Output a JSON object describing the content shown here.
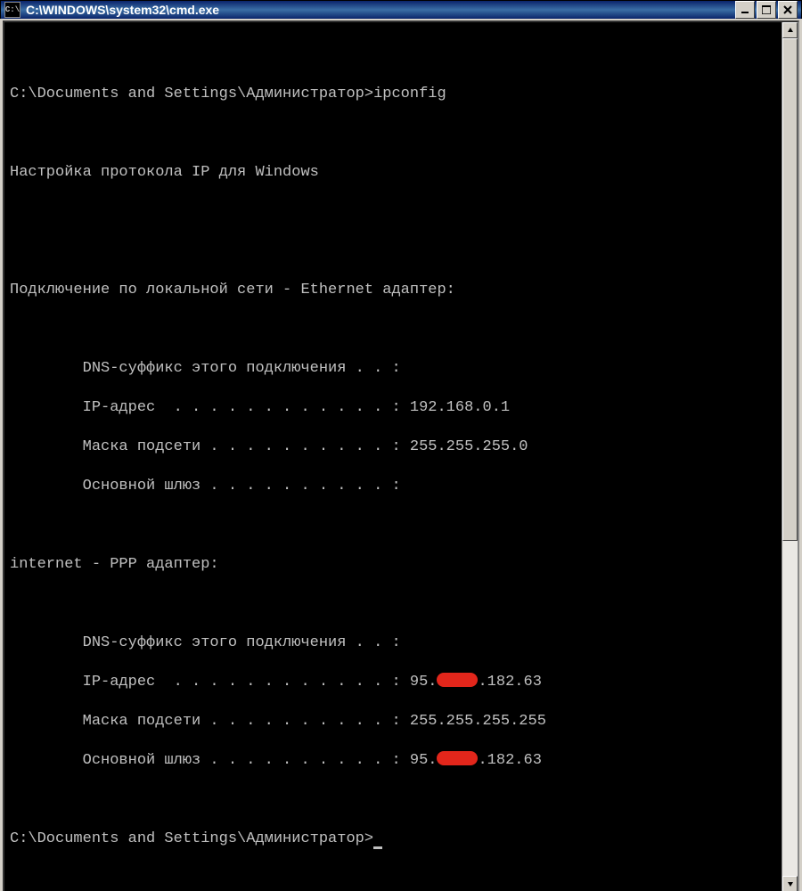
{
  "window": {
    "title": "C:\\WINDOWS\\system32\\cmd.exe",
    "icon_text": "C:\\"
  },
  "terminal": {
    "prompt1_path": "C:\\Documents and Settings\\Администратор>",
    "prompt1_cmd": "ipconfig",
    "header": "Настройка протокола IP для Windows",
    "adapter1_title": "Подключение по локальной сети - Ethernet адаптер:",
    "adapter1": {
      "dns_label": "        DNS-суффикс этого подключения . . :",
      "ip_label": "        IP-адрес  . . . . . . . . . . . . :",
      "ip_value": " 192.168.0.1",
      "mask_label": "        Маска подсети . . . . . . . . . . :",
      "mask_value": " 255.255.255.0",
      "gw_label": "        Основной шлюз . . . . . . . . . . :"
    },
    "adapter2_title": "internet - PPP адаптер:",
    "adapter2": {
      "dns_label": "        DNS-суффикс этого подключения . . :",
      "ip_label": "        IP-адрес  . . . . . . . . . . . . :",
      "ip_prefix": " 95.",
      "ip_suffix": ".182.63",
      "mask_label": "        Маска подсети . . . . . . . . . . :",
      "mask_value": " 255.255.255.255",
      "gw_label": "        Основной шлюз . . . . . . . . . . :",
      "gw_prefix": " 95.",
      "gw_suffix": ".182.63"
    },
    "prompt2_path": "C:\\Documents and Settings\\Администратор>"
  }
}
